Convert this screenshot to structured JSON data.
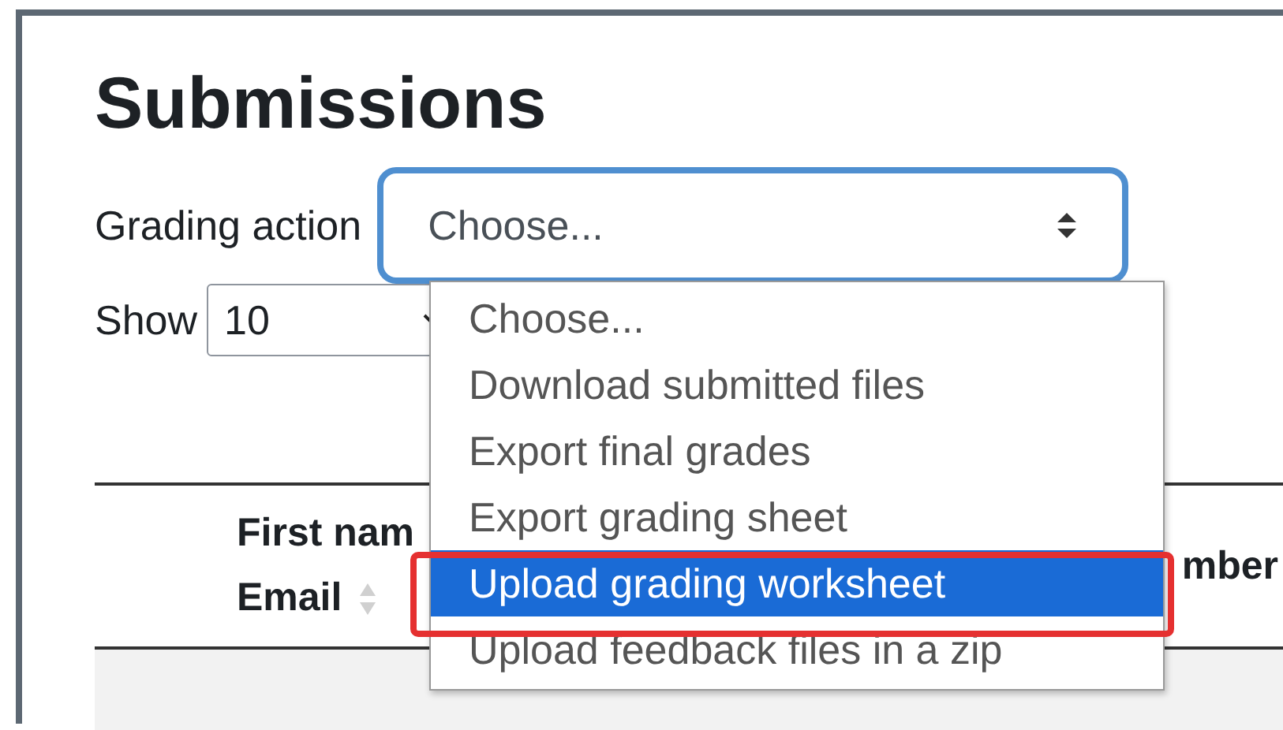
{
  "heading": "Submissions",
  "grading_action": {
    "label": "Grading action",
    "value": "Choose...",
    "expanded": true,
    "options": [
      {
        "label": "Choose...",
        "highlighted": false
      },
      {
        "label": "Download submitted files",
        "highlighted": false
      },
      {
        "label": "Export final grades",
        "highlighted": false
      },
      {
        "label": "Export grading sheet",
        "highlighted": false
      },
      {
        "label": "Upload grading worksheet",
        "highlighted": true
      },
      {
        "label": "Upload feedback files in a zip",
        "highlighted": false
      }
    ]
  },
  "show": {
    "label": "Show",
    "value": "10"
  },
  "table": {
    "columns": [
      {
        "lines": [
          "First nam",
          "Email"
        ]
      },
      {
        "lines": [
          "mber"
        ]
      }
    ]
  }
}
